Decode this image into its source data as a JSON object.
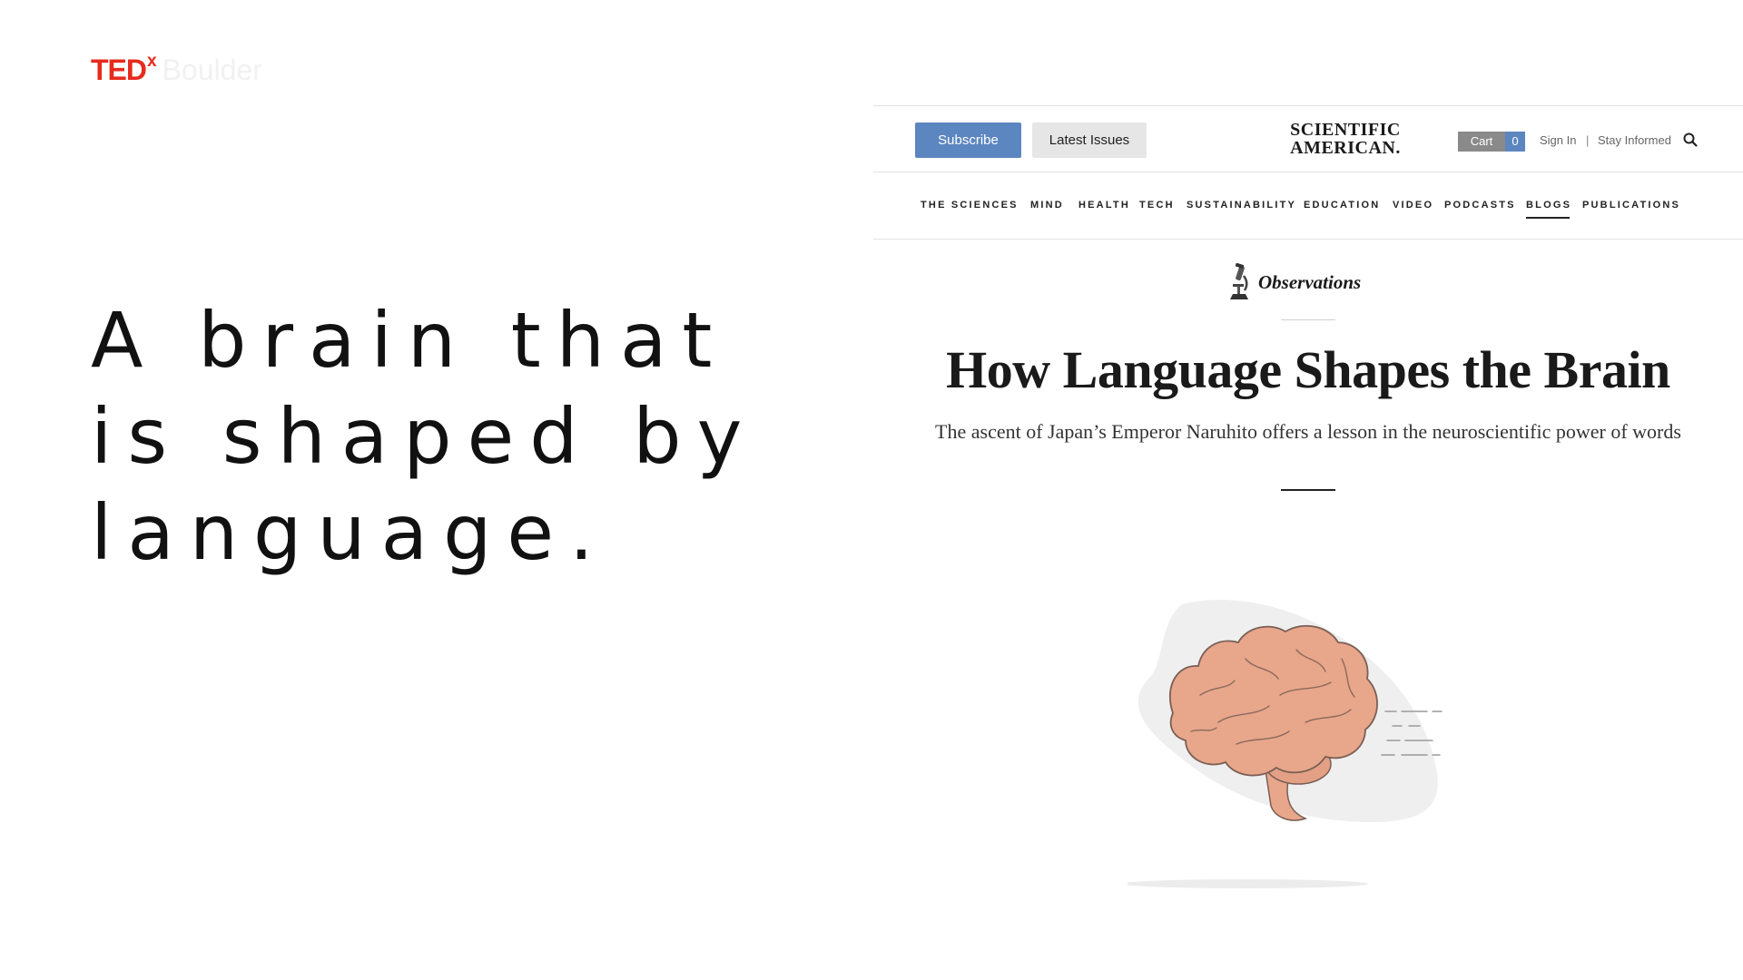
{
  "logo": {
    "ted": "TED",
    "x": "x",
    "city": "Boulder"
  },
  "headline": {
    "lines": [
      "A brain that",
      "is shaped by",
      "language."
    ]
  },
  "site": {
    "header": {
      "subscribe_label": "Subscribe",
      "latest_issues_label": "Latest Issues",
      "logo_line1": "SCIENTIFIC",
      "logo_line2": "AMERICAN.",
      "cart_label": "Cart",
      "cart_count": "0",
      "sign_in_label": "Sign In",
      "separator": "|",
      "stay_informed_label": "Stay Informed",
      "search_icon": "search-icon"
    },
    "nav": {
      "items": [
        {
          "label": "THE SCIENCES"
        },
        {
          "label": "MIND"
        },
        {
          "label": "HEALTH"
        },
        {
          "label": "TECH"
        },
        {
          "label": "SUSTAINABILITY"
        },
        {
          "label": "EDUCATION"
        },
        {
          "label": "VIDEO"
        },
        {
          "label": "PODCASTS"
        },
        {
          "label": "BLOGS"
        },
        {
          "label": "PUBLICATIONS"
        }
      ],
      "active": "BLOGS"
    },
    "article": {
      "section_label": "Observations",
      "section_icon": "microscope-icon",
      "title": "How Language Shapes the Brain",
      "subtitle": "The ascent of Japan’s Emperor Naruhito offers a lesson in the neuroscientific power of words",
      "illustration": "brain-illustration"
    },
    "colors": {
      "subscribe_bg": "#5c86c0",
      "latest_issues_bg": "#e6e6e6",
      "cart_bg": "#8a8a8a",
      "cart_count_bg": "#5c86c0",
      "brain_fill": "#e8a68a",
      "tedx_red": "#e62b1e"
    }
  }
}
